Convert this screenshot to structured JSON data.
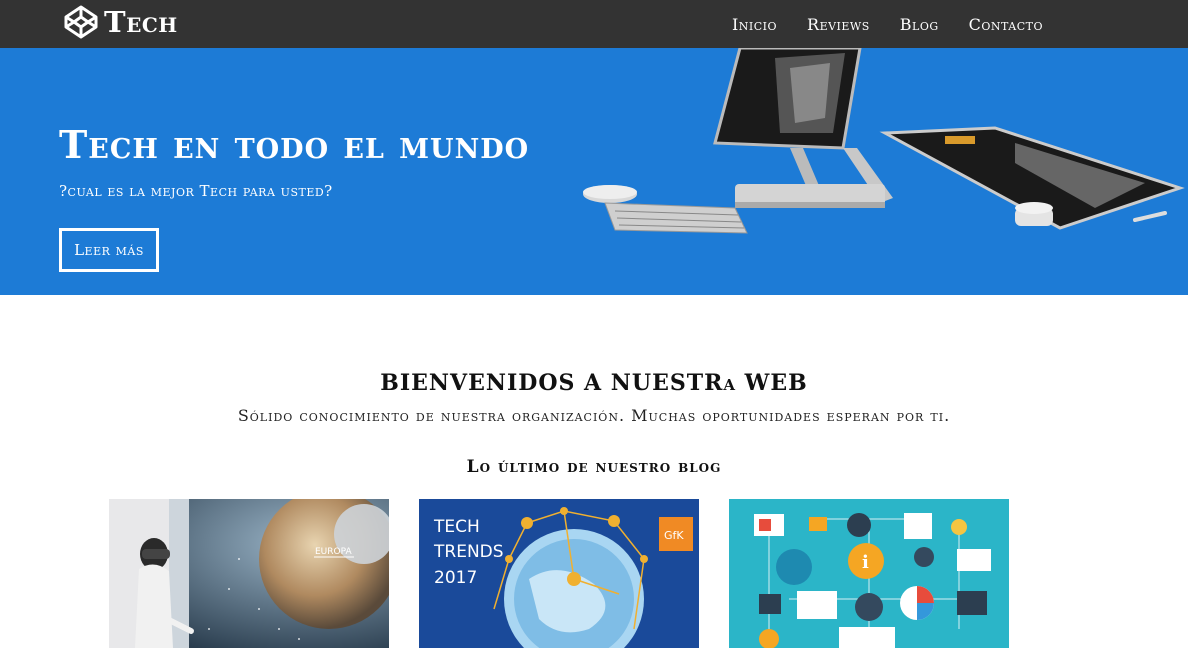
{
  "nav": {
    "logo_text": "Tech",
    "items": [
      {
        "label": "Inicio"
      },
      {
        "label": "Reviews"
      },
      {
        "label": "Blog"
      },
      {
        "label": "Contacto"
      }
    ]
  },
  "hero": {
    "title": "Tech en todo el mundo",
    "subtitle": "?cual es la mejor Tech para usted?",
    "button_label": "Leer más",
    "background_color": "#1d7bd6"
  },
  "welcome": {
    "title": "BIENVENIDOS A NUESTRa WEB",
    "subtitle": "Sólido conocimiento de nuestra organización. Muchas oportunidades esperan por ti."
  },
  "blog": {
    "title": "Lo último de nuestro blog",
    "posts": [
      {
        "image_text": "EUROPA",
        "image_icon": "vr-space-image"
      },
      {
        "image_text_line1": "TECH",
        "image_text_line2": "TRENDS",
        "image_text_line3": "2017",
        "badge": "GfK",
        "image_icon": "globe-network-image"
      },
      {
        "image_icon": "tech-icons-image"
      }
    ]
  },
  "colors": {
    "navbar": "#333333",
    "hero": "#1d7bd6",
    "card2_bg": "#1a4a9a",
    "card3_bg": "#2bb5c8"
  }
}
